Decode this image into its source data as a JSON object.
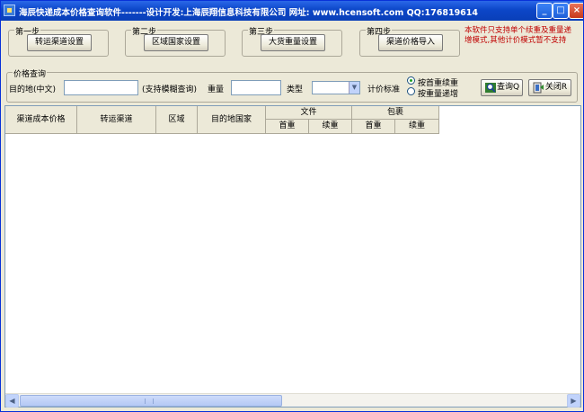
{
  "window": {
    "title": "海辰快递成本价格查询软件-------设计开发:上海辰翔信息科技有限公司 网址: www.hcensoft.com QQ:176819614",
    "min_icon": "_",
    "max_icon": "□",
    "close_icon": "×"
  },
  "steps": [
    {
      "label": "第一步",
      "button": "转运渠道设置"
    },
    {
      "label": "第二步",
      "button": "区域国家设置"
    },
    {
      "label": "第三步",
      "button": "大货重量设置"
    },
    {
      "label": "第四步",
      "button": "渠道价格导入"
    }
  ],
  "notice": "本软件只支持单个续重及重量递增模式,其他计价模式暂不支持",
  "query": {
    "group_label": "价格查询",
    "destination_label": "目的地(中文)",
    "destination_value": "",
    "fuzzy_hint": "(支持模糊查询)",
    "weight_label": "重量",
    "weight_value": "",
    "type_label": "类型",
    "type_value": "",
    "pricing_label": "计价标准",
    "radio1": "按首重续重",
    "radio2": "按重量递增",
    "query_button": "查询Q",
    "close_button": "关闭R"
  },
  "grid": {
    "columns": [
      "渠道成本价格",
      "转运渠道",
      "区域",
      "目的地国家"
    ],
    "group_document": "文件",
    "group_package": "包裹",
    "sub_first": "首重",
    "sub_continue": "续重"
  },
  "colors": {
    "titlebar": "#0c46c8",
    "notice": "#c00000",
    "window_bg": "#ece9d8"
  }
}
